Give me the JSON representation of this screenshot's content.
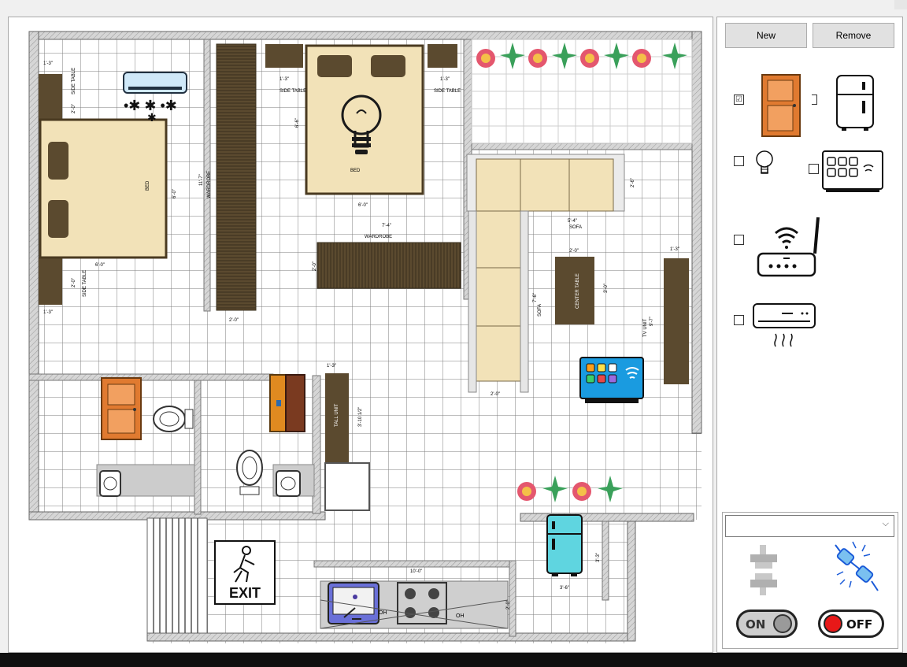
{
  "toolbar": {
    "new_label": "New",
    "remove_label": "Remove"
  },
  "devices": [
    {
      "name": "door",
      "checked": true,
      "mark": "☑"
    },
    {
      "name": "fridge",
      "checked": false,
      "mark": ""
    },
    {
      "name": "bulb",
      "checked": false,
      "mark": ""
    },
    {
      "name": "smart-panel",
      "checked": false,
      "mark": ""
    },
    {
      "name": "router",
      "checked": false,
      "mark": ""
    },
    {
      "name": "air-conditioner",
      "checked": false,
      "mark": ""
    }
  ],
  "controls": {
    "dropdown_value": "",
    "dropdown_arrow": "⌵",
    "on_label": "ON",
    "off_label": "OFF"
  },
  "plan": {
    "exit_label": "EXIT",
    "bed1": "BED",
    "bed2": "BED",
    "wardrobe_v": "WARDROBE",
    "wardrobe_h": "WARDROBE",
    "side_table_l1": "SIDE TABLE",
    "side_table_l2": "SIDE TABLE",
    "side_table_t1": "SIDE TABLE",
    "side_table_t2": "SIDE TABLE",
    "sofa_top": "SOFA",
    "sofa_side": "SOFA",
    "center_table": "CENTER TABLE",
    "tv_unit": "TV UNIT",
    "tall_unit": "TALL UNIT",
    "oh1": "OH",
    "oh2": "OH",
    "dims": {
      "d1": "1'-3\"",
      "d2": "2'-0\"",
      "d3": "6'-0\"",
      "d4": "11'-7\"",
      "d5": "2'-0\"",
      "d6": "1'-3\"",
      "d7": "6'-6\"",
      "d8": "6'-0\"",
      "d9": "1'-3\"",
      "d10": "7'-4\"",
      "d11": "2'-0\"",
      "d12": "2'-6\"",
      "d13": "2'-0\"",
      "d14": "5'-4\"",
      "d15": "7'-6\"",
      "d16": "3'-0\"",
      "d17": "2'-0\"",
      "d18": "1'-3\"",
      "d19": "3'-10 1/2\"",
      "d20": "10'-0\"",
      "d21": "2'-0\"",
      "d22": "3'-3\"",
      "d23": "3'-6\"",
      "d24": "1'-3\"",
      "d25": "9'-7\"",
      "d26": "2'-0\"",
      "d27": "1'-3\"",
      "d28": "2'-0\"",
      "d29": "2'-0\""
    }
  },
  "colors": {
    "wall": "#c4c4c4",
    "wood_dark": "#5a4a30",
    "bed_fill": "#f2e2b8",
    "door_orange": "#e07a30",
    "fridge_cyan": "#5fd5e0",
    "tv_blue": "#1a9be0",
    "off_red": "#e81818"
  }
}
